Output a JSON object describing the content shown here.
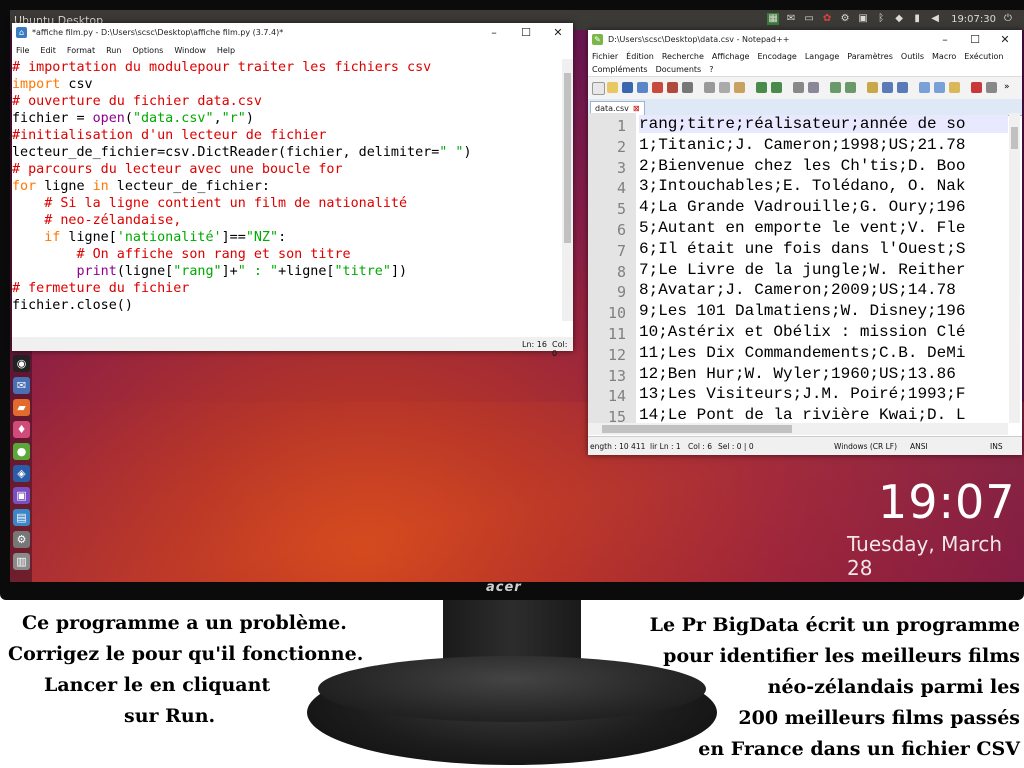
{
  "desktop": {
    "title": "Ubuntu Desktop",
    "tray_time": "19:07:30",
    "clock_time": "19:07",
    "clock_date": "Tuesday, March 28",
    "monitor_brand": "acer"
  },
  "idle": {
    "title": "*affiche film.py - D:\\Users\\scsc\\Desktop\\affiche film.py (3.7.4)*",
    "menu": [
      "File",
      "Edit",
      "Format",
      "Run",
      "Options",
      "Window",
      "Help"
    ],
    "code_lines": [
      "# importation du modulepour traiter les fichiers csv",
      "import csv",
      "# ouverture du fichier data.csv",
      "fichier = open(\"data.csv\",\"r\")",
      "#initialisation d'un lecteur de fichier",
      "lecteur_de_fichier=csv.DictReader(fichier, delimiter=\" \")",
      "# parcours du lecteur avec une boucle for",
      "for ligne in lecteur_de_fichier:",
      "    # Si la ligne contient un film de nationalité",
      "    # neo-zélandaise,",
      "    if ligne['nationalité']==\"NZ\":",
      "        # On affiche son rang et son titre",
      "        print(ligne[\"rang\"]+\" : \"+ligne[\"titre\"])",
      "# fermeture du fichier",
      "fichier.close()"
    ],
    "status_ln": "Ln: 16",
    "status_col": "Col: 0"
  },
  "notepad": {
    "title": "D:\\Users\\scsc\\Desktop\\data.csv - Notepad++",
    "menu_row1": [
      "Fichier",
      "Édition",
      "Recherche",
      "Affichage",
      "Encodage",
      "Langage",
      "Paramètres",
      "Outils",
      "Macro",
      "Exécution"
    ],
    "menu_row2": [
      "Compléments",
      "Documents",
      "?"
    ],
    "tab_label": "data.csv",
    "line_numbers": [
      "1",
      "2",
      "3",
      "4",
      "5",
      "6",
      "7",
      "8",
      "9",
      "10",
      "11",
      "12",
      "13",
      "14",
      "15"
    ],
    "lines": [
      "rang;titre;réalisateur;année de so",
      "1;Titanic;J. Cameron;1998;US;21.78",
      "2;Bienvenue chez les Ch'tis;D. Boo",
      "3;Intouchables;E. Tolédano, O. Nak",
      "4;La Grande Vadrouille;G. Oury;196",
      "5;Autant en emporte le vent;V. Fle",
      "6;Il était une fois dans l'Ouest;S",
      "7;Le Livre de la jungle;W. Reither",
      "8;Avatar;J. Cameron;2009;US;14.78",
      "9;Les 101 Dalmatiens;W. Disney;196",
      "10;Astérix et Obélix : mission Clé",
      "11;Les Dix Commandements;C.B. DeMi",
      "12;Ben Hur;W. Wyler;1960;US;13.86",
      "13;Les Visiteurs;J.M. Poiré;1993;F",
      "14;Le Pont de la rivière Kwai;D. L"
    ],
    "status_length": "ength : 10 411",
    "status_lines": "lir Ln : 1",
    "status_col": "Col : 6",
    "status_sel": "Sel : 0 | 0",
    "status_eol": "Windows (CR LF)",
    "status_enc": "ANSI",
    "status_ins": "INS"
  },
  "captions": {
    "left": [
      "Ce programme a un problème.",
      "Corrigez le pour qu'il fonctionne.",
      "Lancer le en cliquant",
      "sur Run."
    ],
    "right": [
      "Le Pr BigData écrit un programme",
      "pour identifier les meilleurs films",
      "néo-zélandais parmi les",
      "200 meilleurs films passés",
      "en France dans un fichier CSV"
    ]
  }
}
